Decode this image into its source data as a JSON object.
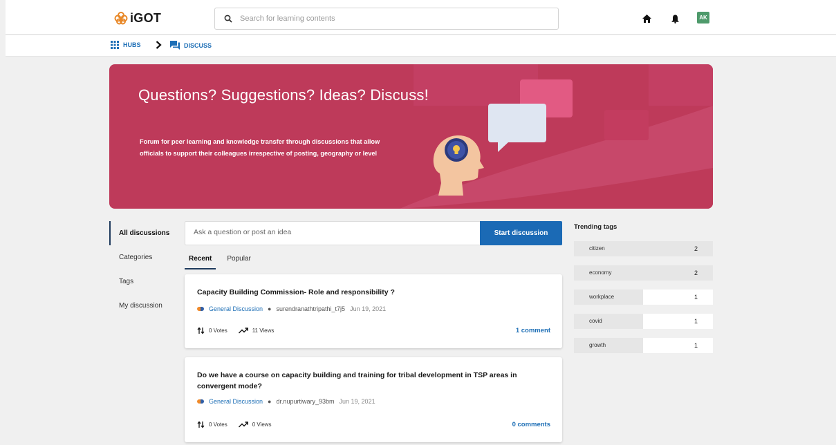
{
  "header": {
    "logo_text": "iGOT",
    "search_placeholder": "Search for learning contents",
    "avatar_initials": "AK"
  },
  "breadcrumb": {
    "hubs_label": "HUBS",
    "discuss_label": "DISCUSS"
  },
  "hero": {
    "title": "Questions? Suggestions? Ideas? Discuss!",
    "description": "Forum for peer learning and knowledge transfer through discussions that allow officials to support their colleagues irrespective of posting, geography or level"
  },
  "sidebar": {
    "items": [
      {
        "label": "All discussions"
      },
      {
        "label": "Categories"
      },
      {
        "label": "Tags"
      },
      {
        "label": "My discussion"
      }
    ]
  },
  "ask": {
    "placeholder": "Ask a question or post an idea",
    "button_label": "Start discussion"
  },
  "tabs": [
    {
      "label": "Recent"
    },
    {
      "label": "Popular"
    }
  ],
  "discussions": [
    {
      "title": "Capacity Building Commission- Role and responsibility ?",
      "category": "General Discussion",
      "author": "surendranathtripathi_t7j5",
      "date": "Jun 19, 2021",
      "votes": "0 Votes",
      "views": "11 Views",
      "comments": "1 comment"
    },
    {
      "title": "Do we have a course on capacity building and training for tribal development in TSP areas in convergent mode?",
      "category": "General Discussion",
      "author": "dr.nupurtiwary_93bm",
      "date": "Jun 19, 2021",
      "votes": "0 Votes",
      "views": "0 Views",
      "comments": "0 comments"
    }
  ],
  "trending": {
    "heading": "Trending tags",
    "tags": [
      {
        "name": "citizen",
        "count": "2",
        "fill": 1.0
      },
      {
        "name": "economy",
        "count": "2",
        "fill": 1.0
      },
      {
        "name": "workplace",
        "count": "1",
        "fill": 0.5
      },
      {
        "name": "covid",
        "count": "1",
        "fill": 0.5
      },
      {
        "name": "growth",
        "count": "1",
        "fill": 0.5
      }
    ]
  },
  "colors": {
    "accent": "#1b6ab5",
    "hero_bg": "#be3a5a",
    "avatar_bg": "#4e9a6b"
  }
}
